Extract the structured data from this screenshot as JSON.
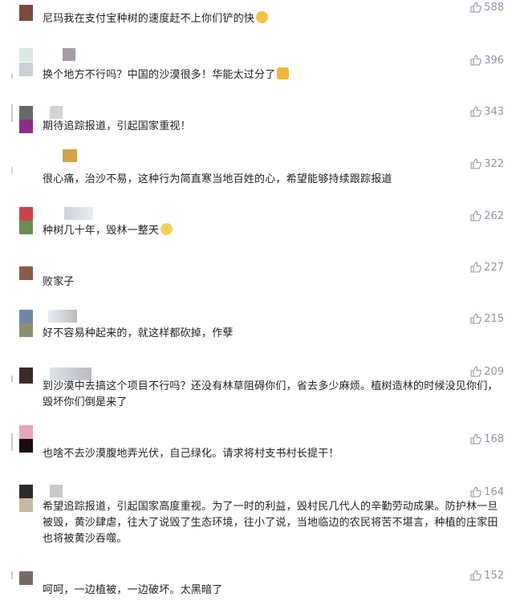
{
  "comments": [
    {
      "likes": "588",
      "text": "尼玛我在支付宝种树的速度赶不上你们铲的快",
      "emoji": "laughing-emoji"
    },
    {
      "likes": "396",
      "text": "换个地方不行吗？中国的沙漠很多！华能太过分了",
      "emoji": "thumbs-down-emoji"
    },
    {
      "likes": "343",
      "text": "期待追踪报道，引起国家重视！"
    },
    {
      "likes": "322",
      "text": "很心痛，治沙不易，这种行为简直寒当地百姓的心，希望能够持续跟踪报道"
    },
    {
      "likes": "262",
      "text": "种树几十年，毁林一整天",
      "emoji": "smile-emoji"
    },
    {
      "likes": "227",
      "text": "败家子"
    },
    {
      "likes": "215",
      "text": "好不容易种起来的，就这样都砍掉，作孽"
    },
    {
      "likes": "209",
      "text": "到沙漠中去搞这个项目不行吗？还没有林草阻碍你们，省去多少麻烦。植树造林的时候没见你们，毁坏你们倒是来了"
    },
    {
      "likes": "168",
      "text": "也啥不去沙漠腹地弄光伏，自己绿化。请求将村支书村长提干！"
    },
    {
      "likes": "164",
      "text": "希望追踪报道，引起国家高度重视。为了一时的利益，毁村民几代人的辛勤劳动成果。防护林一旦被毁，黄沙肆虐，往大了说毁了生态环境，往小了说，当地临边的农民将苦不堪言，种植的庄家田也将被黄沙吞噬。"
    },
    {
      "likes": "152",
      "text": "呵呵，一边植被，一边破坏。太黑暗了"
    }
  ],
  "colors": {
    "like_color": "#8a95a8",
    "text_color": "#222222"
  }
}
